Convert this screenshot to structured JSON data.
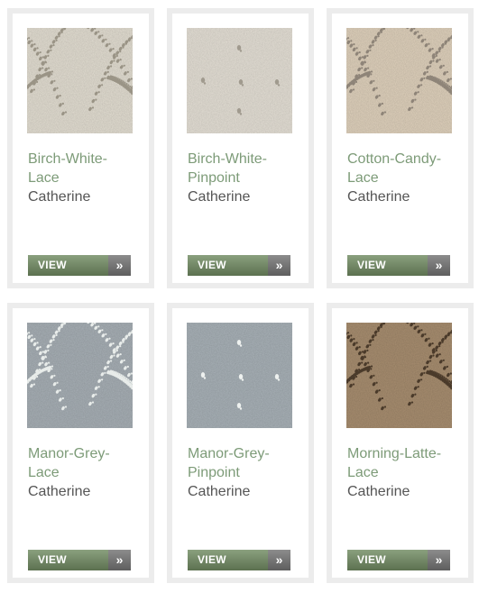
{
  "products": [
    {
      "name": "Birch-White-Lace",
      "name_lines": [
        "Birch-White-",
        "Lace"
      ],
      "brand": "Catherine",
      "button": "VIEW",
      "arrow": "»",
      "swatch": {
        "base": "#e4dfd3",
        "accent": "#9a9486",
        "pattern": "lace"
      }
    },
    {
      "name": "Birch-White-Pinpoint",
      "name_lines": [
        "Birch-White-",
        "Pinpoint"
      ],
      "brand": "Catherine",
      "button": "VIEW",
      "arrow": "»",
      "swatch": {
        "base": "#e6e1d7",
        "accent": "#a09a8e",
        "pattern": "pinpoint"
      }
    },
    {
      "name": "Cotton-Candy-Lace",
      "name_lines": [
        "Cotton-Candy-",
        "Lace"
      ],
      "brand": "Catherine",
      "button": "VIEW",
      "arrow": "»",
      "swatch": {
        "base": "#e0d2bd",
        "accent": "#8e8478",
        "pattern": "lace"
      }
    },
    {
      "name": "Manor-Grey-Lace",
      "name_lines": [
        "Manor-Grey-",
        "Lace"
      ],
      "brand": "Catherine",
      "button": "VIEW",
      "arrow": "»",
      "swatch": {
        "base": "#a8b0b6",
        "accent": "#e8ecea",
        "pattern": "lace"
      }
    },
    {
      "name": "Manor-Grey-Pinpoint",
      "name_lines": [
        "Manor-Grey-",
        "Pinpoint"
      ],
      "brand": "Catherine",
      "button": "VIEW",
      "arrow": "»",
      "swatch": {
        "base": "#a9b2b8",
        "accent": "#eef1ef",
        "pattern": "pinpoint"
      }
    },
    {
      "name": "Morning-Latte-Lace",
      "name_lines": [
        "Morning-Latte-",
        "Lace"
      ],
      "brand": "Catherine",
      "button": "VIEW",
      "arrow": "»",
      "swatch": {
        "base": "#a88e70",
        "accent": "#4a3a2a",
        "pattern": "lace"
      }
    }
  ],
  "colors": {
    "card_border": "#ececec",
    "product_name": "#7d9b78",
    "brand_text": "#555555",
    "button_green": "#6f845f",
    "button_grey": "#777777"
  }
}
